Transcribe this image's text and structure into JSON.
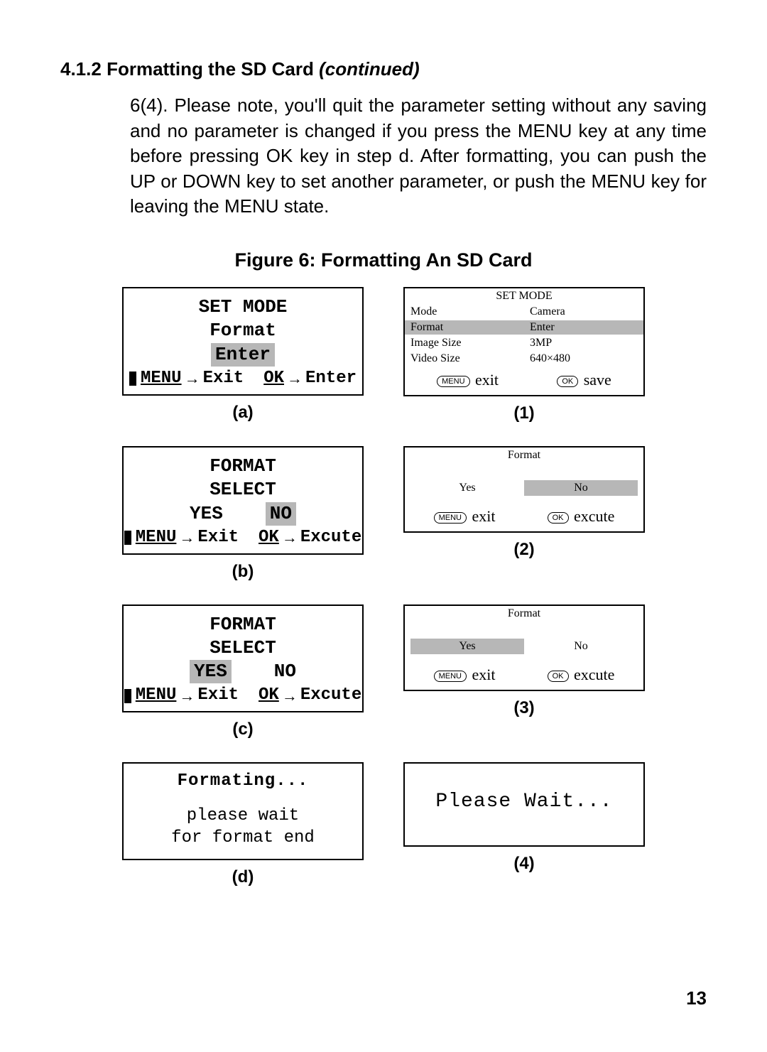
{
  "section": {
    "number": "4.1.2",
    "title": "Formatting the SD Card",
    "continued": "(continued)"
  },
  "paragraph": "6(4). Please note, you'll quit the parameter setting without any saving and no parameter is changed if you press the MENU key at any time before pressing OK key in step d. After formatting, you can push the UP or DOWN key to set another parameter, or push the MENU key for leaving the MENU state.",
  "figure": {
    "caption": "Figure 6: Formatting An SD Card",
    "left_nav": {
      "menu_label": "MENU",
      "ok_label": "OK",
      "exit": "Exit",
      "enter": "Enter",
      "excute": "Excute"
    },
    "right_nav": {
      "menu_pill": "MENU",
      "ok_pill": "OK",
      "exit": "exit",
      "save": "save",
      "excute": "excute"
    },
    "panels": {
      "a": {
        "caption": "(a)",
        "line1": "SET MODE",
        "line2": "Format",
        "enter_hilite": "Enter"
      },
      "b": {
        "caption": "(b)",
        "line1": "FORMAT",
        "line2": "SELECT",
        "yes": "YES",
        "no": "NO",
        "selected": "no"
      },
      "c": {
        "caption": "(c)",
        "line1": "FORMAT",
        "line2": "SELECT",
        "yes": "YES",
        "no": "NO",
        "selected": "yes"
      },
      "d": {
        "caption": "(d)",
        "line1": "Formating...",
        "line2": "please wait",
        "line3": "for format end"
      },
      "p1": {
        "caption": "(1)",
        "title": "SET MODE",
        "rows": [
          {
            "label": "Mode",
            "value": "Camera",
            "selected": false
          },
          {
            "label": "Format",
            "value": "Enter",
            "selected": true
          },
          {
            "label": "Image Size",
            "value": "3MP",
            "selected": false
          },
          {
            "label": "Video Size",
            "value": "640×480",
            "selected": false
          }
        ]
      },
      "p2": {
        "caption": "(2)",
        "title": "Format",
        "yes": "Yes",
        "no": "No",
        "selected": "no"
      },
      "p3": {
        "caption": "(3)",
        "title": "Format",
        "yes": "Yes",
        "no": "No",
        "selected": "yes"
      },
      "p4": {
        "caption": "(4)",
        "text": "Please Wait..."
      }
    }
  },
  "page_number": "13"
}
